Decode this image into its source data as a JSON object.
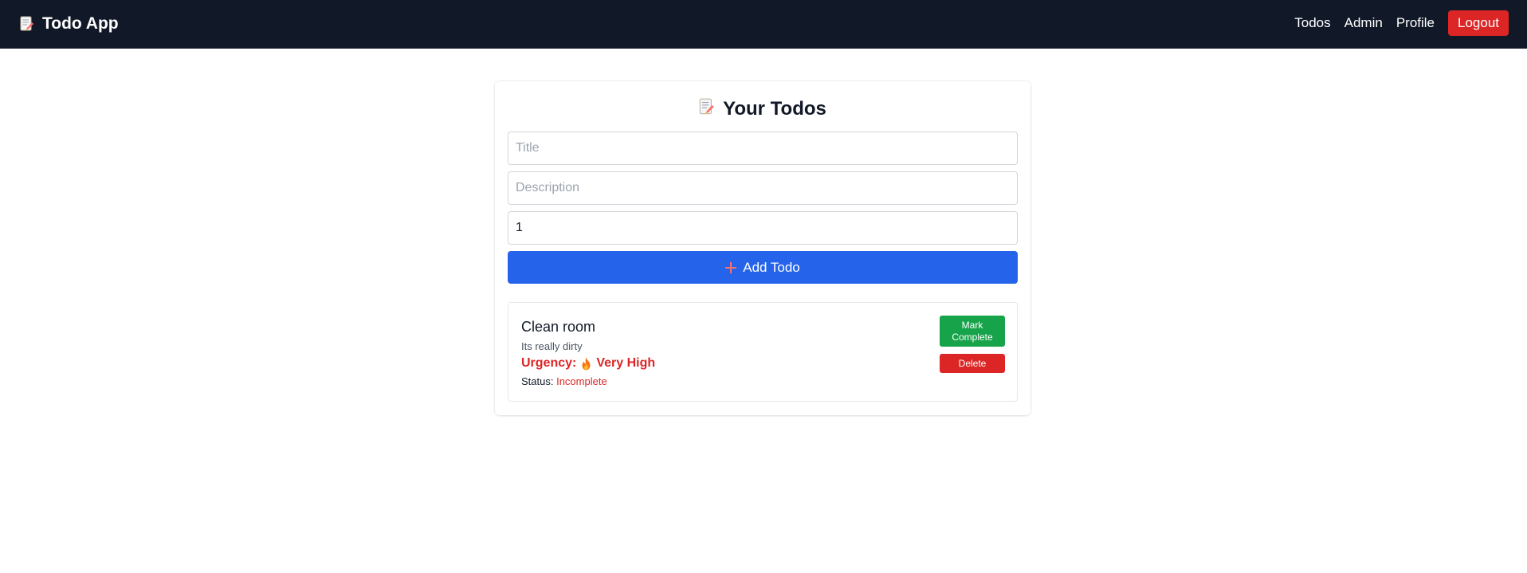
{
  "app": {
    "brand": "Todo App",
    "brand_icon": "memo-icon"
  },
  "nav": {
    "links": [
      "Todos",
      "Admin",
      "Profile"
    ],
    "logout_label": "Logout"
  },
  "main": {
    "heading": "Your Todos",
    "heading_icon": "memo-icon",
    "form": {
      "title_placeholder": "Title",
      "description_placeholder": "Description",
      "urgency_value": "1",
      "add_label": "Add Todo",
      "add_icon": "plus-icon"
    },
    "todos": [
      {
        "title": "Clean room",
        "description": "Its really dirty",
        "urgency_label": "Urgency:",
        "urgency_value": "Very High",
        "urgency_icon": "fire-icon",
        "status_label": "Status:",
        "status_value": "Incomplete",
        "complete_label": "Mark Complete",
        "delete_label": "Delete"
      }
    ]
  },
  "colors": {
    "navbar_bg": "#111827",
    "primary": "#2563eb",
    "danger": "#dc2626",
    "success": "#16a34a"
  }
}
